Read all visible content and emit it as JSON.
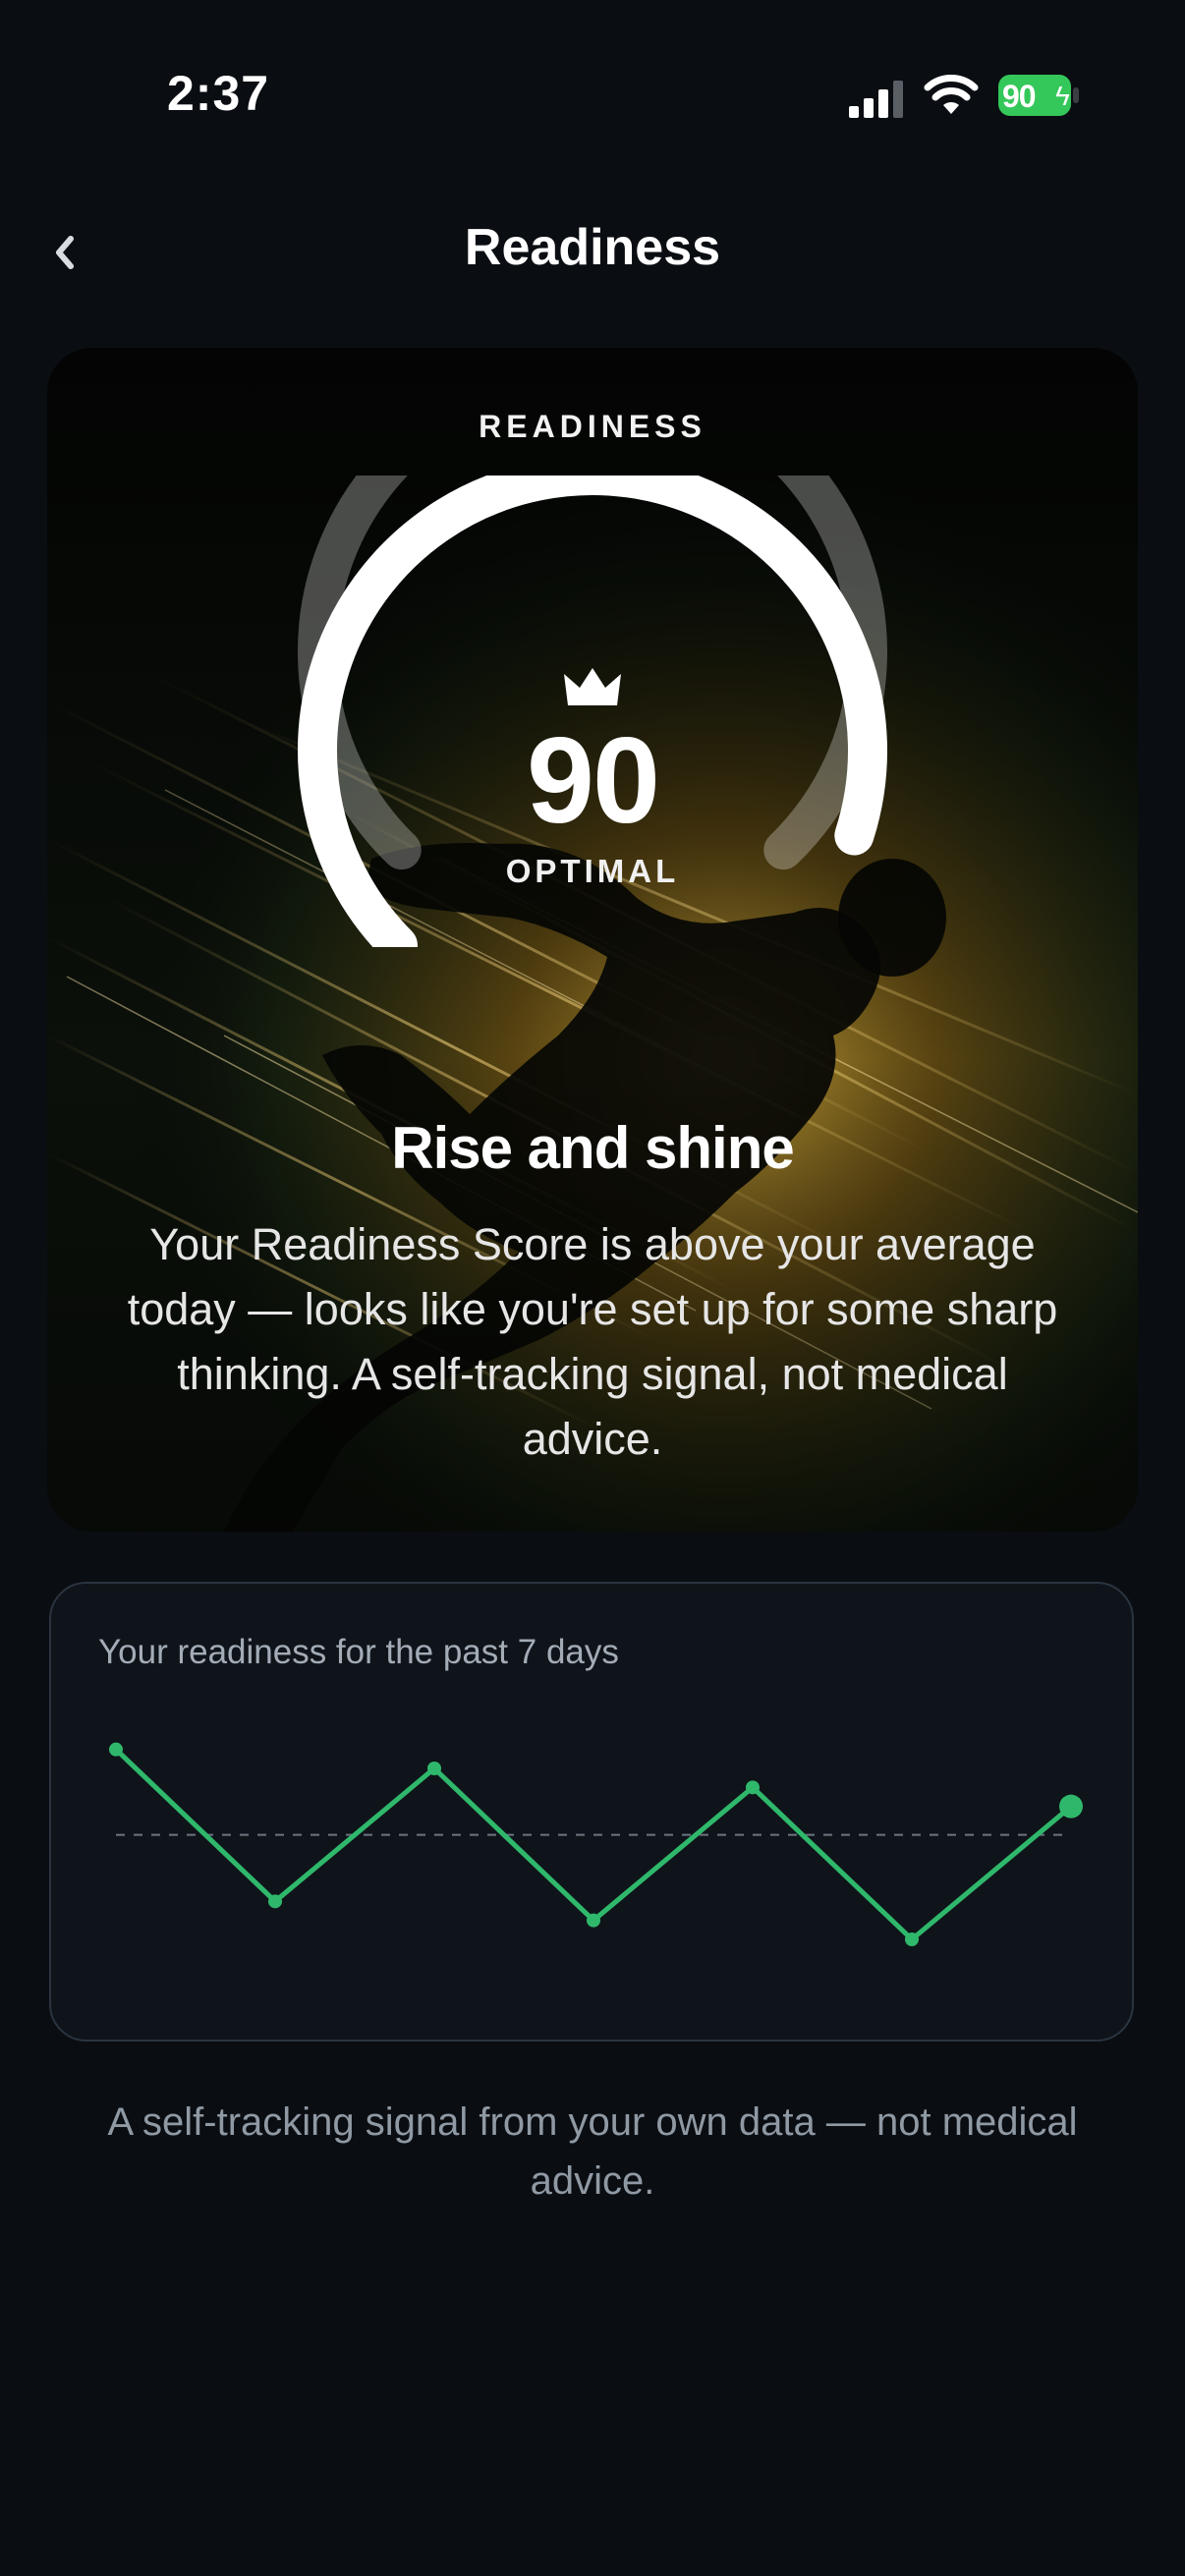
{
  "status_bar": {
    "time": "2:37",
    "battery_level": "90",
    "battery_color": "#34c759"
  },
  "nav": {
    "back_icon": "chevron-left-icon",
    "title": "Readiness"
  },
  "hero": {
    "label": "READINESS",
    "score": "90",
    "score_max": 100,
    "status": "OPTIMAL",
    "headline": "Rise and shine",
    "body": "Your Readiness Score is above your average today — looks like you're set up for some sharp thinking. A self-tracking signal, not medical advice.",
    "icon": "crown-icon"
  },
  "trend": {
    "title": "Your readiness for the past 7 days",
    "accent_color": "#2fb86c"
  },
  "chart_data": {
    "type": "line",
    "x": [
      1,
      2,
      3,
      4,
      5,
      6,
      7
    ],
    "values": [
      88,
      72,
      86,
      70,
      84,
      68,
      82
    ],
    "baseline": 79,
    "ylim": [
      62,
      92
    ],
    "grid": false
  },
  "footer": {
    "note": "A self-tracking signal from your own data — not medical advice."
  }
}
